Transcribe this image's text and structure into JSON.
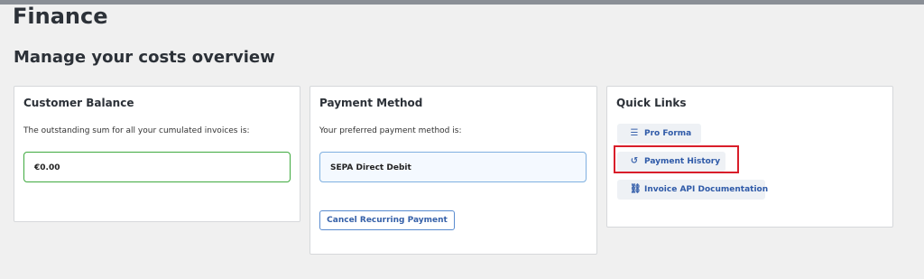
{
  "page": {
    "title": "Finance",
    "subtitle": "Manage your costs overview"
  },
  "balance": {
    "title": "Customer Balance",
    "description": "The outstanding sum for all your cumulated invoices is:",
    "amount": "€0.00"
  },
  "payment": {
    "title": "Payment Method",
    "description": "Your preferred payment method is:",
    "method": "SEPA Direct Debit",
    "cancel_label": "Cancel Recurring Payment"
  },
  "quick_links": {
    "title": "Quick Links",
    "items": [
      {
        "label": "Pro Forma",
        "icon": "list-icon"
      },
      {
        "label": "Payment History",
        "icon": "history-icon"
      },
      {
        "label": "Invoice API Documentation",
        "icon": "link-icon"
      }
    ]
  },
  "colors": {
    "highlight": "#d91e2a",
    "balance_border": "#3faa3f",
    "link_text": "#2f5aa8"
  }
}
